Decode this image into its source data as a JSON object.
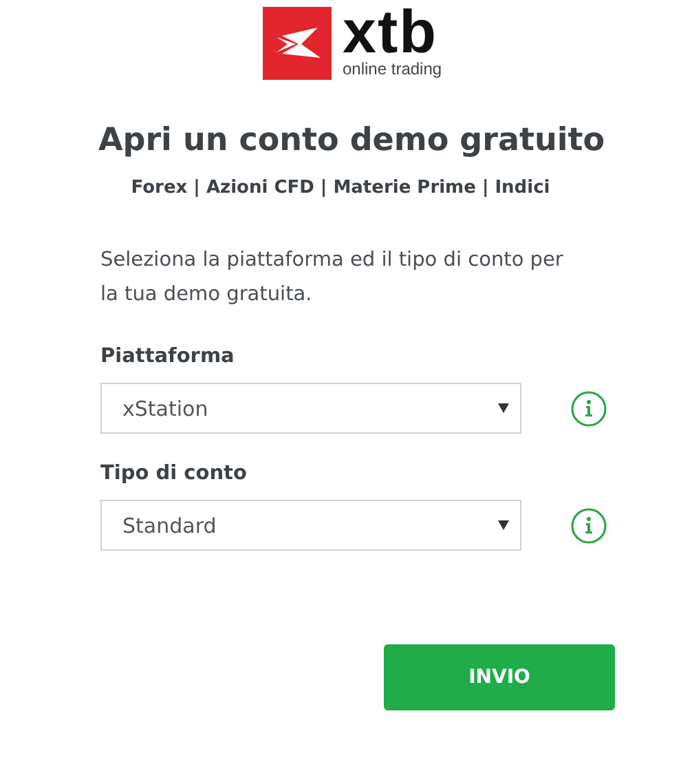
{
  "logo": {
    "wordmark": "xtb",
    "tagline": "online trading"
  },
  "title": "Apri un conto demo gratuito",
  "subtitle": "Forex | Azioni CFD | Materie Prime | Indici",
  "intro": "Seleziona la piattaforma ed il tipo di conto per la tua demo gratuita.",
  "fields": [
    {
      "label": "Piattaforma",
      "value": "xStation"
    },
    {
      "label": "Tipo di conto",
      "value": "Standard"
    }
  ],
  "submit": "INVIO"
}
